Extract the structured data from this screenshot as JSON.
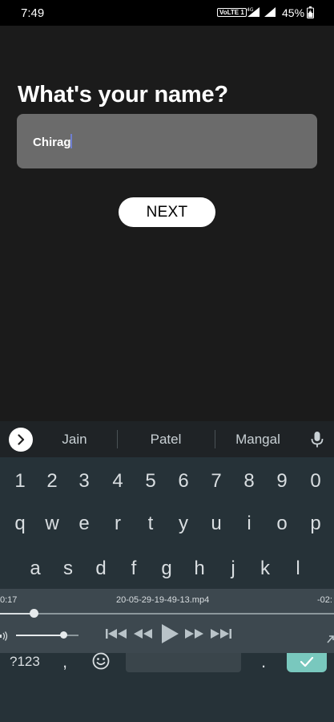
{
  "status_bar": {
    "time": "7:49",
    "volte": "VoLTE 1",
    "network": "4G",
    "battery": "45%"
  },
  "screen": {
    "question": "What's your name?",
    "name_value": "Chirag",
    "next_label": "NEXT"
  },
  "keyboard": {
    "suggestions": [
      "Jain",
      "Patel",
      "Mangal"
    ],
    "number_row": [
      "1",
      "2",
      "3",
      "4",
      "5",
      "6",
      "7",
      "8",
      "9",
      "0"
    ],
    "row_q": [
      "q",
      "w",
      "e",
      "r",
      "t",
      "y",
      "u",
      "i",
      "o",
      "p"
    ],
    "row_a": [
      "a",
      "s",
      "d",
      "f",
      "g",
      "h",
      "j",
      "k",
      "l"
    ],
    "symbols_label": "?123",
    "comma": ",",
    "period": ".",
    "accent_color": "#79c8be"
  },
  "player": {
    "time_elapsed": "0:17",
    "file_name": "20-05-29-19-49-13.mp4",
    "time_remaining": "-02:",
    "seek_progress": 0.1,
    "volume_level": 0.8
  }
}
